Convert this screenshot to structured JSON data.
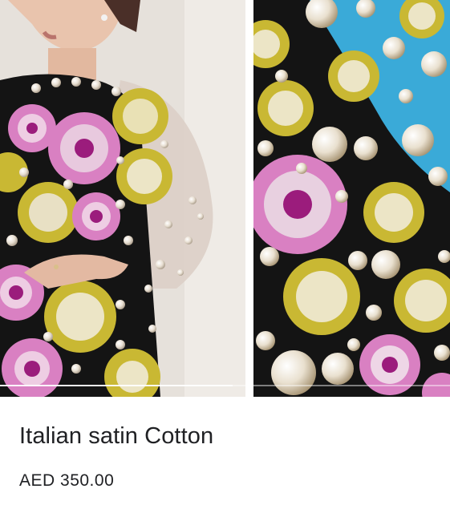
{
  "product": {
    "title": "Italian satin Cotton",
    "price": "AED 350.00"
  },
  "gallery": {
    "left_image": "model-wearing-embellished-dress",
    "right_image": "printed-fabric-closeup"
  },
  "colors": {
    "fabric_black": "#141414",
    "medallion_pink": "#d980c2",
    "medallion_yellow": "#c9b833",
    "pearl": "#efe6d6",
    "accent_blue": "#3aaad8"
  }
}
